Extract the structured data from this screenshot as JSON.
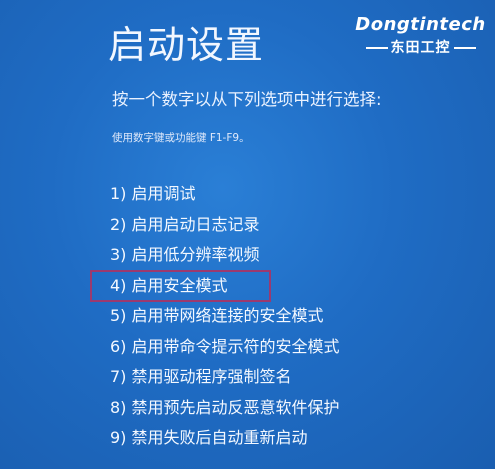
{
  "screen": {
    "title": "启动设置",
    "instruction": "按一个数字以从下列选项中进行选择:",
    "hint": "使用数字键或功能键 F1-F9。",
    "options": [
      "1) 启用调试",
      "2) 启用启动日志记录",
      "3) 启用低分辨率视频",
      "4) 启用安全模式",
      "5) 启用带网络连接的安全模式",
      "6) 启用带命令提示符的安全模式",
      "7) 禁用驱动程序强制签名",
      "8) 禁用预先启动反恶意软件保护",
      "9) 禁用失败后自动重新启动"
    ],
    "selected_option_index": 3
  },
  "watermark": {
    "brand": "Dongtintech",
    "brand_cn": "东田工控"
  },
  "colors": {
    "background": "#1f6cc4",
    "highlight_border": "#9b3a6f",
    "text": "#ffffff"
  }
}
